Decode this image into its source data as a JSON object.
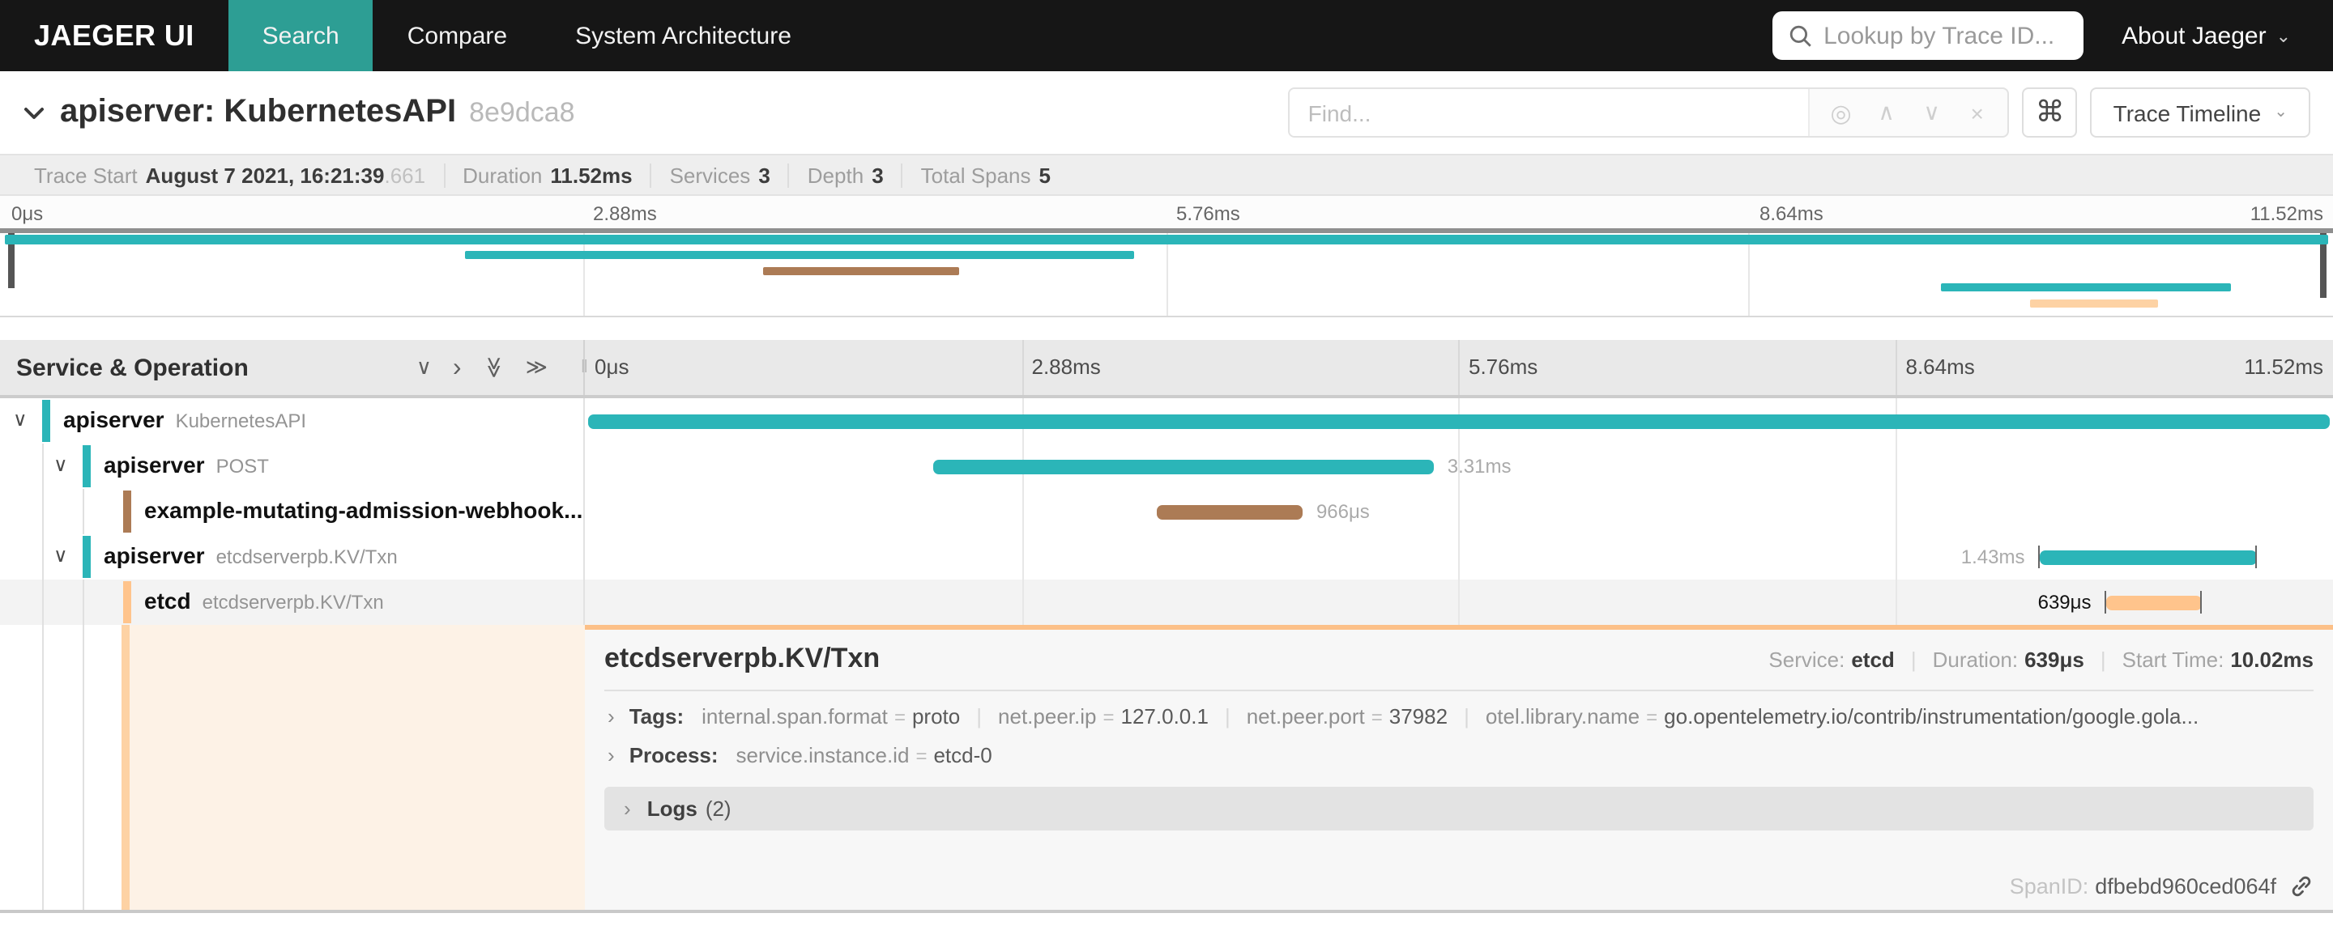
{
  "colors": {
    "teal": "#2bb5b8",
    "brown": "#ac7b55",
    "orange": "#ffc48c",
    "orange_light": "#fdd2a4",
    "highlight_bg": "#fdf2e6",
    "detail_border": "#fcc088",
    "nav_active": "#2d9e94"
  },
  "icons": {
    "chevron_down": "∨",
    "chevron_right": "›",
    "double_chevron": "≫",
    "chevron_small": "⌄",
    "locate": "◎",
    "up": "∧",
    "down": "∨",
    "close": "×",
    "command": "⌘"
  },
  "nav": {
    "brand": "JAEGER UI",
    "items": [
      {
        "label": "Search",
        "active": true
      },
      {
        "label": "Compare",
        "active": false
      },
      {
        "label": "System Architecture",
        "active": false
      }
    ],
    "lookup_placeholder": "Lookup by Trace ID...",
    "about": "About Jaeger"
  },
  "trace_header": {
    "title": "apiserver: KubernetesAPI",
    "trace_id": "8e9dca8",
    "find_placeholder": "Find...",
    "view_button": "Trace Timeline"
  },
  "summary": {
    "items": [
      {
        "label": "Trace Start",
        "value": "August 7 2021, 16:21:39",
        "frac": ".661"
      },
      {
        "label": "Duration",
        "value": "11.52ms",
        "frac": ""
      },
      {
        "label": "Services",
        "value": "3",
        "frac": ""
      },
      {
        "label": "Depth",
        "value": "3",
        "frac": ""
      },
      {
        "label": "Total Spans",
        "value": "5",
        "frac": ""
      }
    ]
  },
  "ticks": [
    "0μs",
    "2.88ms",
    "5.76ms",
    "8.64ms",
    "11.52ms"
  ],
  "timeline": {
    "header_title": "Service & Operation",
    "spans": [
      {
        "service": "apiserver",
        "operation": "KubernetesAPI",
        "depth": 0,
        "color": "teal",
        "start_pct": 0.2,
        "width_pct": 99.6,
        "duration": "",
        "label_side": "none",
        "expandable": true,
        "end_ticks": false,
        "selected": false
      },
      {
        "service": "apiserver",
        "operation": "POST",
        "depth": 1,
        "color": "teal",
        "start_pct": 19.9,
        "width_pct": 28.7,
        "duration": "3.31ms",
        "label_side": "right",
        "expandable": true,
        "end_ticks": false,
        "selected": false
      },
      {
        "service": "example-mutating-admission-webhook...",
        "operation": "",
        "depth": 2,
        "color": "brown",
        "start_pct": 32.7,
        "width_pct": 8.4,
        "duration": "966μs",
        "label_side": "right",
        "expandable": false,
        "end_ticks": false,
        "selected": false
      },
      {
        "service": "apiserver",
        "operation": "etcdserverpb.KV/Txn",
        "depth": 1,
        "color": "teal",
        "start_pct": 83.2,
        "width_pct": 12.4,
        "duration": "1.43ms",
        "label_side": "left",
        "expandable": true,
        "end_ticks": true,
        "selected": false
      },
      {
        "service": "etcd",
        "operation": "etcdserverpb.KV/Txn",
        "depth": 2,
        "color": "orange",
        "start_pct": 87.0,
        "width_pct": 5.5,
        "duration": "639μs",
        "label_side": "left",
        "expandable": false,
        "end_ticks": true,
        "selected": true
      }
    ]
  },
  "detail": {
    "title": "etcdserverpb.KV/Txn",
    "service_label": "Service:",
    "service": "etcd",
    "duration_label": "Duration:",
    "duration": "639μs",
    "start_label": "Start Time:",
    "start": "10.02ms",
    "tags_label": "Tags:",
    "eq": "=",
    "tags": [
      {
        "k": "internal.span.format",
        "v": "proto"
      },
      {
        "k": "net.peer.ip",
        "v": "127.0.0.1"
      },
      {
        "k": "net.peer.port",
        "v": "37982"
      },
      {
        "k": "otel.library.name",
        "v": "go.opentelemetry.io/contrib/instrumentation/google.gola..."
      }
    ],
    "process_label": "Process:",
    "process": [
      {
        "k": "service.instance.id",
        "v": "etcd-0"
      }
    ],
    "logs_label": "Logs",
    "logs_count": "(2)",
    "spanid_label": "SpanID:",
    "spanid": "dfbebd960ced064f"
  }
}
